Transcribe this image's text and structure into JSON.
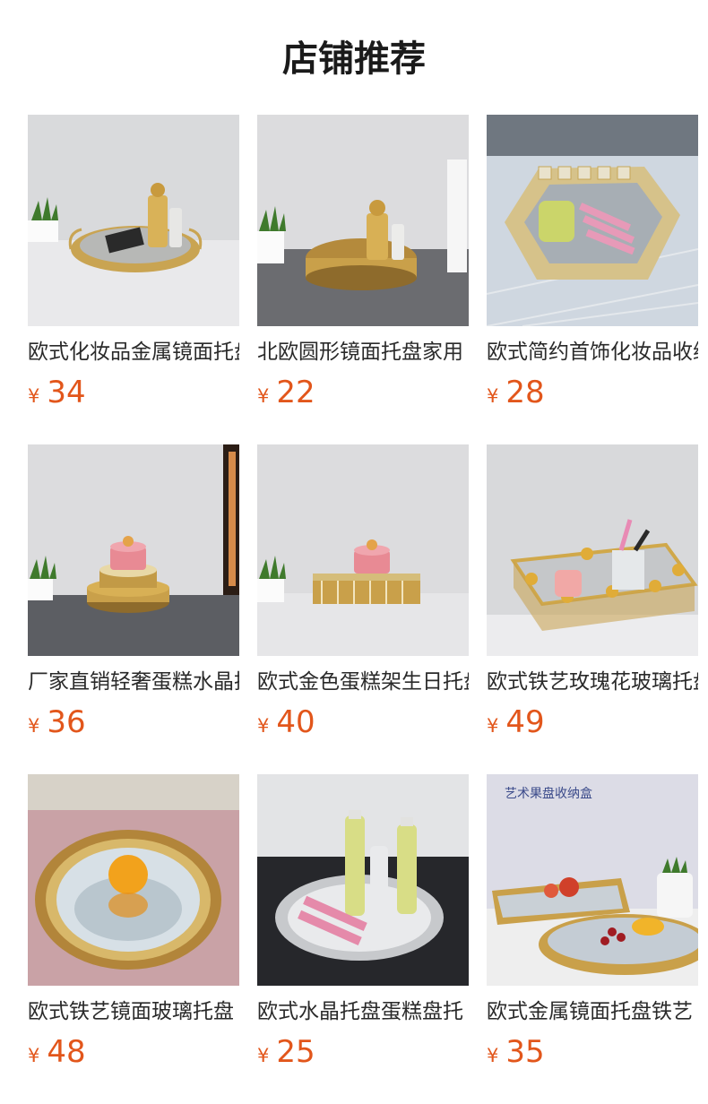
{
  "page_title": "店铺推荐",
  "currency_symbol": "¥",
  "products": [
    {
      "name": "欧式化妆品金属镜面托盘",
      "price": "34",
      "image": "oval-gold-tray-with-perfume-photo"
    },
    {
      "name": "北欧圆形镜面托盘家用",
      "price": "22",
      "image": "round-gold-tray-with-perfume-photo"
    },
    {
      "name": "欧式简约首饰化妆品收纳盘",
      "price": "28",
      "image": "hexagon-crystal-tray-with-brushes-photo"
    },
    {
      "name": "厂家直销轻奢蛋糕水晶托盘",
      "price": "36",
      "image": "two-tier-cake-tray-photo"
    },
    {
      "name": "欧式金色蛋糕架生日托盘",
      "price": "40",
      "image": "rectangular-cake-stand-photo"
    },
    {
      "name": "欧式铁艺玫瑰花玻璃托盘",
      "price": "49",
      "image": "rose-iron-glass-tray-photo"
    },
    {
      "name": "欧式铁艺镜面玻璃托盘",
      "price": "48",
      "image": "mirror-tray-with-orange-photo"
    },
    {
      "name": "欧式水晶托盘蛋糕盘托",
      "price": "25",
      "image": "crystal-round-tray-with-bottles-photo"
    },
    {
      "name": "欧式金属镜面托盘铁艺",
      "price": "35",
      "image": "fruit-trays-photo",
      "caption": "艺术果盘收纳盒"
    }
  ]
}
